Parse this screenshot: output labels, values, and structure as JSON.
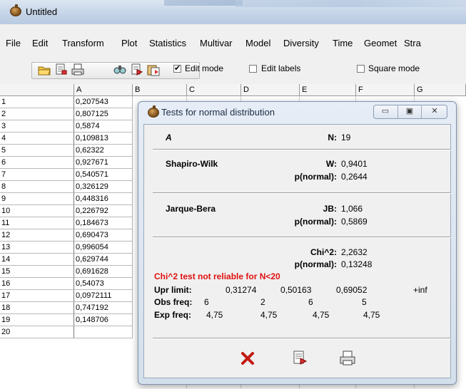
{
  "window": {
    "title": "Untitled"
  },
  "menu": [
    "File",
    "Edit",
    "Transform",
    "Plot",
    "Statistics",
    "Multivar",
    "Model",
    "Diversity",
    "Time",
    "Geomet",
    "Stra"
  ],
  "toolbar": {
    "buttons": [
      "open-folder-icon",
      "import-icon",
      "print-icon",
      "find-icon",
      "copy-icon",
      "paste-icon"
    ],
    "edit_mode": {
      "label": "Edit mode",
      "checked": true
    },
    "edit_labels": {
      "label": "Edit labels",
      "checked": false
    },
    "square_mode": {
      "label": "Square mode",
      "checked": false
    }
  },
  "grid": {
    "columns": [
      "A",
      "B",
      "C",
      "D",
      "E",
      "F",
      "G"
    ],
    "rows": [
      "1",
      "2",
      "3",
      "4",
      "5",
      "6",
      "7",
      "8",
      "9",
      "10",
      "11",
      "12",
      "13",
      "14",
      "15",
      "16",
      "17",
      "18",
      "19",
      "20"
    ],
    "col_a": [
      "0,207543",
      "0,807125",
      "0,5874",
      "0,109813",
      "0,62322",
      "0,927671",
      "0,540571",
      "0,326129",
      "0,448316",
      "0,226792",
      "0,184673",
      "0,690473",
      "0,996054",
      "0,629744",
      "0,691628",
      "0,54073",
      "0,0972111",
      "0,747192",
      "0,148706",
      ""
    ]
  },
  "dialog": {
    "title": "Tests for normal distribution",
    "column": "A",
    "n_label": "N:",
    "n_value": "19",
    "shapiro": {
      "name": "Shapiro-Wilk",
      "w_label": "W:",
      "w_value": "0,9401",
      "p_label": "p(normal):",
      "p_value": "0,2644"
    },
    "jarque": {
      "name": "Jarque-Bera",
      "jb_label": "JB:",
      "jb_value": "1,066",
      "p_label": "p(normal):",
      "p_value": "0,5869"
    },
    "chi": {
      "chi_label": "Chi^2:",
      "chi_value": "2,2632",
      "p_label": "p(normal):",
      "p_value": "0,13248",
      "warning": "Chi^2 test not reliable for N<20",
      "upr_label": "Upr limit:",
      "upr": [
        "0,31274",
        "0,50163",
        "0,69052",
        "+inf"
      ],
      "obs_label": "Obs freq:",
      "obs": [
        "6",
        "2",
        "6",
        "5"
      ],
      "exp_label": "Exp freq:",
      "exp": [
        "4,75",
        "4,75",
        "4,75",
        "4,75"
      ]
    },
    "warn_color": "#e01010"
  }
}
